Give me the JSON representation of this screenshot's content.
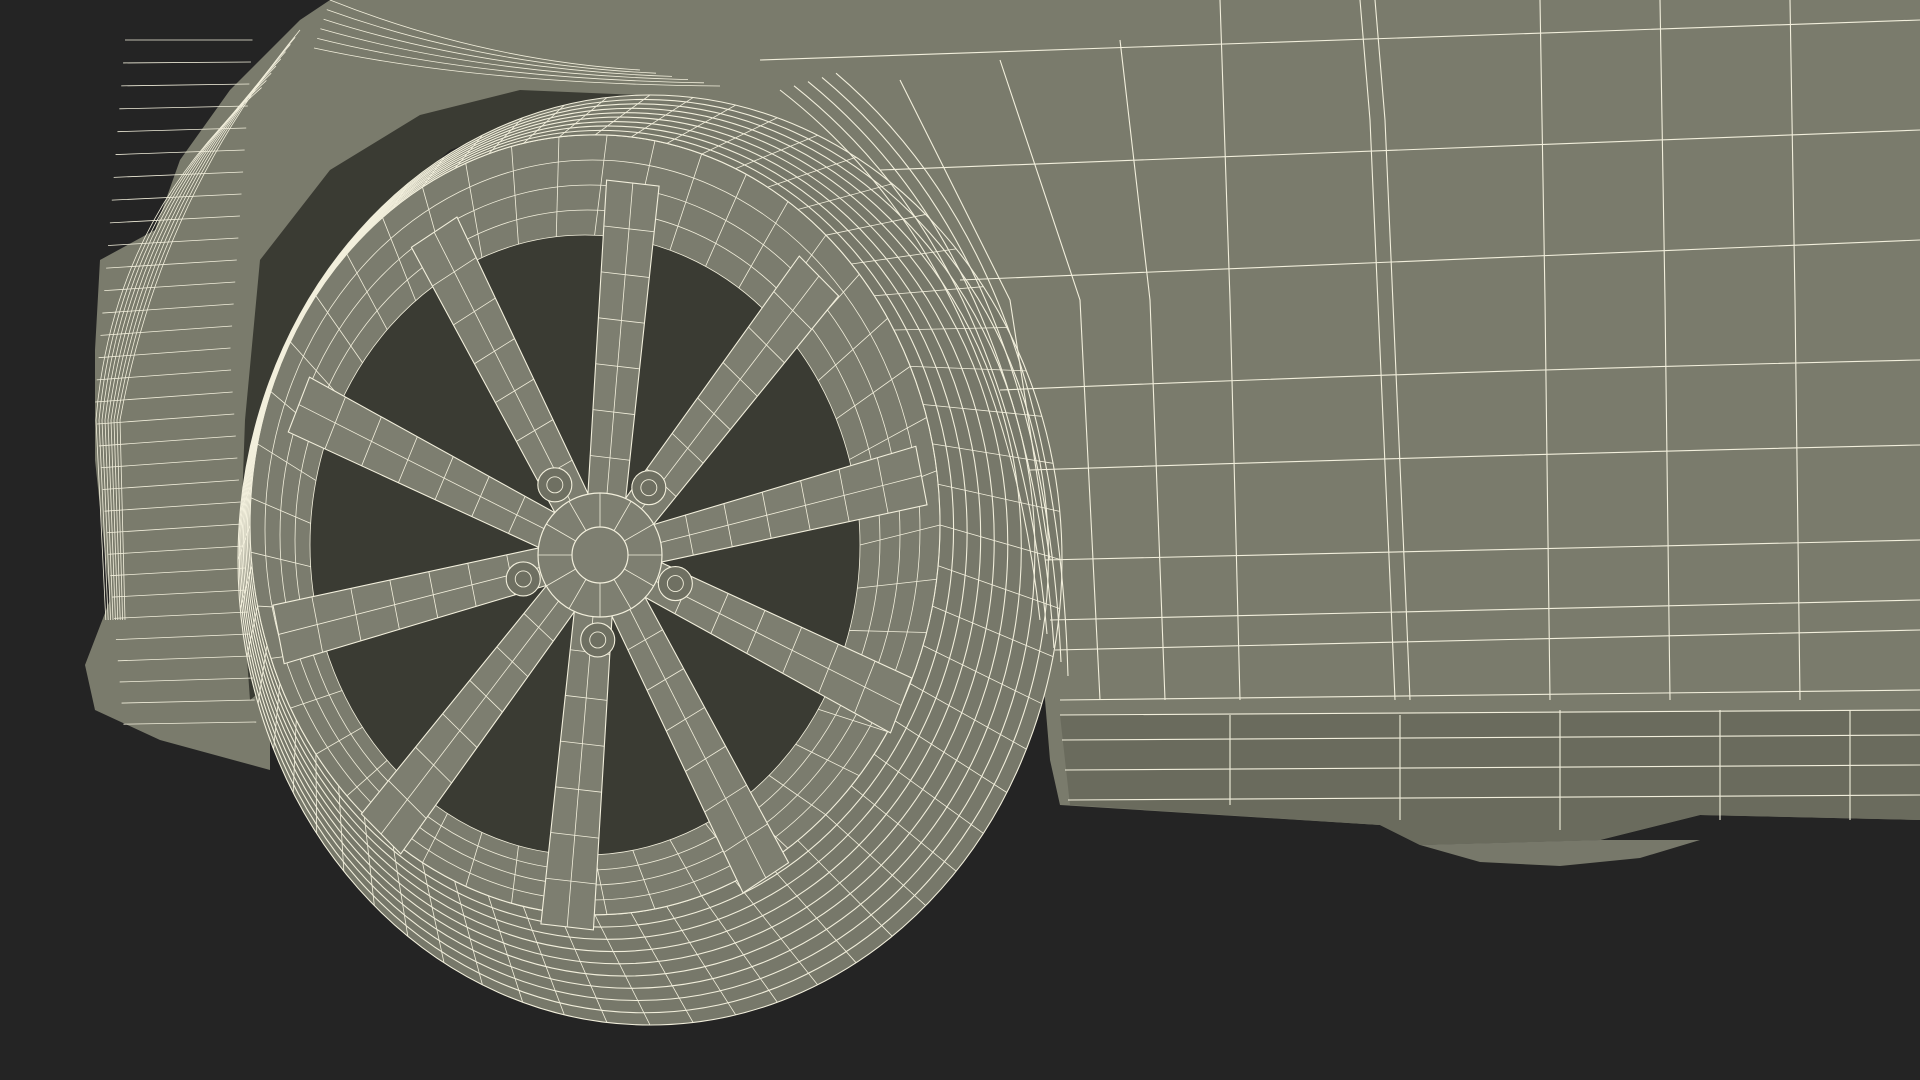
{
  "scene": {
    "subject": "car-front-wheel-wireframe",
    "background_color": "#242424",
    "surface_color": "#7a7b6c",
    "wire_color": "#f2efdc",
    "wheel": {
      "spokes": 10,
      "lug_nuts": 5
    }
  }
}
